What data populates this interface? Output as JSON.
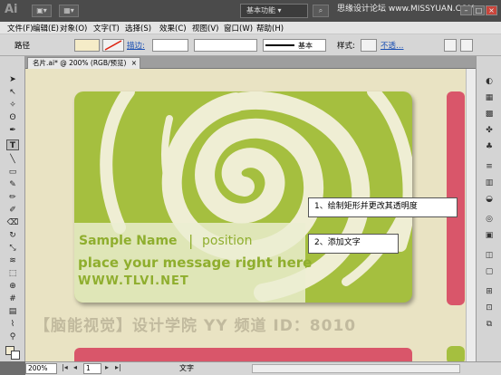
{
  "app": {
    "logo": "Ai",
    "workspace": "基本功能",
    "watermark_top": "思缘设计论坛 www.MISSYUAN.COM",
    "win_buttons": [
      "minimize",
      "maximize",
      "close"
    ]
  },
  "menu": [
    "文件(F)",
    "编辑(E)",
    "对象(O)",
    "文字(T)",
    "选择(S)",
    "效果(C)",
    "视图(V)",
    "窗口(W)",
    "帮助(H)"
  ],
  "control": {
    "path_label": "路径",
    "stroke_label": "描边:",
    "style_value": "基本",
    "style_label": "样式:",
    "opacity_label": "不透…"
  },
  "document": {
    "tab_title": "名片.ai* @ 200% (RGB/预览)",
    "tab_close": "×"
  },
  "card": {
    "name": "Sample Name",
    "separator": "|",
    "position": "position",
    "message": "place your message right here",
    "url": "WWW.TLVI.NET"
  },
  "callouts": {
    "step1": "1、绘制矩形并更改其透明度",
    "step2": "2、添加文字"
  },
  "watermark": "【脑能视觉】设计学院  YY 频道 ID：8010",
  "status": {
    "zoom": "200%",
    "page": "1",
    "mode": "文字"
  },
  "colors": {
    "card_green": "#a5bf3f",
    "swirl_cream": "#efeed4",
    "artboard": "#e9e3c3",
    "card_pink": "#d9566a"
  }
}
